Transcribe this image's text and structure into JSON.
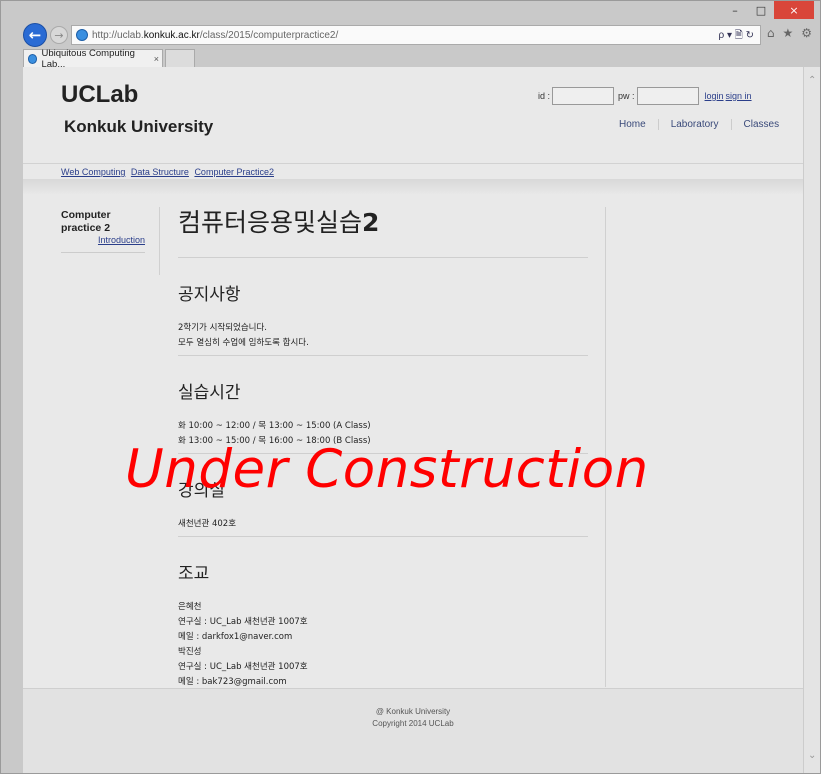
{
  "window": {
    "minimize": "–",
    "maximize": "□",
    "close": "×"
  },
  "browser": {
    "url_prefix": "http://uclab.",
    "url_host": "konkuk.ac.kr",
    "url_path": "/class/2015/computerpractice2/",
    "tab_title": "Ubiquitous Computing Lab...",
    "tab_close": "×",
    "addr_tools": "ρ ▾ 🗎 ↻",
    "home": "⌂",
    "favorites": "★",
    "settings": "⚙"
  },
  "header": {
    "site_title": "UCLab",
    "site_subtitle": "Konkuk University",
    "id_label": "id :",
    "pw_label": "pw :",
    "login": "login",
    "signin": "sign in",
    "nav": [
      "Home",
      "Laboratory",
      "Classes"
    ]
  },
  "breadcrumbs": [
    "Web Computing",
    "Data Structure",
    "Computer Practice2"
  ],
  "sidebar": {
    "title": "Computer practice 2",
    "link": "Introduction"
  },
  "main": {
    "title_hangul": "컴퓨터응용및실습",
    "title_num": "2",
    "sections": [
      {
        "heading": "공지사항",
        "lines": [
          "2학기가 시작되었습니다.",
          "모두 열심히 수업에 임하도록 합시다."
        ]
      },
      {
        "heading": "실습시간",
        "lines": [
          "화 10:00 ~ 12:00 / 목 13:00 ~ 15:00 (A Class)",
          "화 13:00 ~ 15:00 / 목 16:00 ~ 18:00 (B Class)"
        ]
      },
      {
        "heading": "강의실",
        "lines": [
          "새천년관 402호"
        ]
      },
      {
        "heading": "조교",
        "lines": [
          "은혜천",
          "연구실 : UC_Lab 새천년관 1007호",
          "메일 : darkfox1@naver.com",
          "박진성",
          "연구실 : UC_Lab 새천년관 1007호",
          "메일 : bak723@gmail.com"
        ]
      }
    ]
  },
  "watermark": "Under Construction",
  "footer": {
    "line1": "@ Konkuk University",
    "line2": "Copyright 2014 UCLab"
  },
  "colors": {
    "watermark": "#ff0000",
    "link": "#2a3e8a",
    "back_button": "#2a6bd4"
  }
}
